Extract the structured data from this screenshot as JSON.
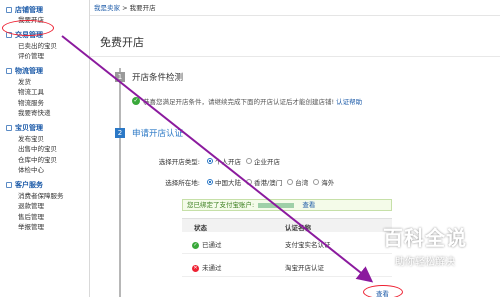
{
  "sidebar": {
    "sections": [
      {
        "title": "店铺管理",
        "items": [
          "我要开店"
        ]
      },
      {
        "title": "交易管理",
        "items": [
          "已卖出的宝贝",
          "评价管理"
        ]
      },
      {
        "title": "物流管理",
        "items": [
          "发货",
          "物流工具",
          "物流服务",
          "我要寄快递"
        ]
      },
      {
        "title": "宝贝管理",
        "items": [
          "发布宝贝",
          "出售中的宝贝",
          "仓库中的宝贝",
          "体检中心"
        ]
      },
      {
        "title": "客户服务",
        "items": [
          "消费者保障服务",
          "退款管理",
          "售后管理",
          "举报管理"
        ]
      }
    ]
  },
  "breadcrumb": {
    "root": "我是卖家",
    "sep": ">",
    "current": "我要开店"
  },
  "page": {
    "title": "免费开店"
  },
  "step1": {
    "num": "1",
    "title": "开店条件检测",
    "notice": "恭喜您满足开店条件，请继续完成下面的开店认证后才能创建店铺!",
    "notice_link": "认证帮助"
  },
  "step2": {
    "num": "2",
    "title": "申请开店认证"
  },
  "form": {
    "shop_type": {
      "label": "选择开店类型:",
      "options": [
        "个人开店",
        "企业开店"
      ]
    },
    "region": {
      "label": "选择所在地:",
      "options": [
        "中国大陆",
        "香港/澳门",
        "台湾",
        "海外"
      ]
    },
    "verify": {
      "label": "认证:",
      "text": "您已绑定了支付宝账户:",
      "link": "查看"
    }
  },
  "table": {
    "headers": [
      "状态",
      "认证名称"
    ],
    "rows": [
      {
        "status": "已通过",
        "name": "支付宝实名认证",
        "action": ""
      },
      {
        "status": "未通过",
        "name": "淘宝开店认证",
        "action": "查看"
      }
    ]
  },
  "watermark": {
    "logo": "百科全说",
    "sub": "助你轻松解决"
  }
}
